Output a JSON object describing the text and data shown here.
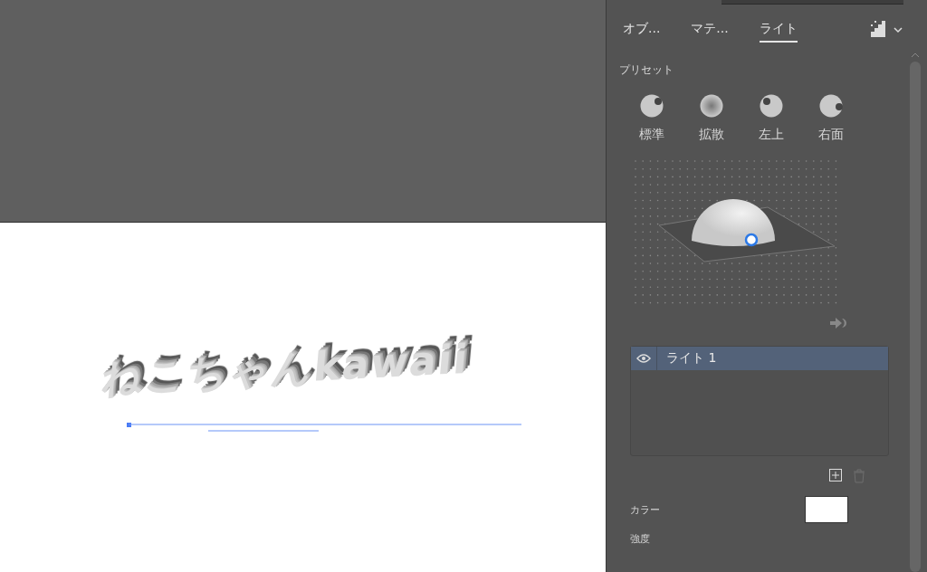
{
  "canvas": {
    "artwork_text": "ねこちゃんkawaii"
  },
  "panel": {
    "tabs": [
      {
        "label": "オブ...",
        "selected": false
      },
      {
        "label": "マテ...",
        "selected": false
      },
      {
        "label": "ライト",
        "selected": true
      }
    ],
    "presets_heading": "プリセット",
    "presets": [
      {
        "label": "標準",
        "kind": "standard"
      },
      {
        "label": "拡散",
        "kind": "diffuse"
      },
      {
        "label": "左上",
        "kind": "top-left"
      },
      {
        "label": "右面",
        "kind": "right"
      }
    ],
    "lights": [
      {
        "name": "ライト 1",
        "visible": true,
        "selected": true
      }
    ],
    "color_label": "カラー",
    "intensity_label": "強度"
  }
}
